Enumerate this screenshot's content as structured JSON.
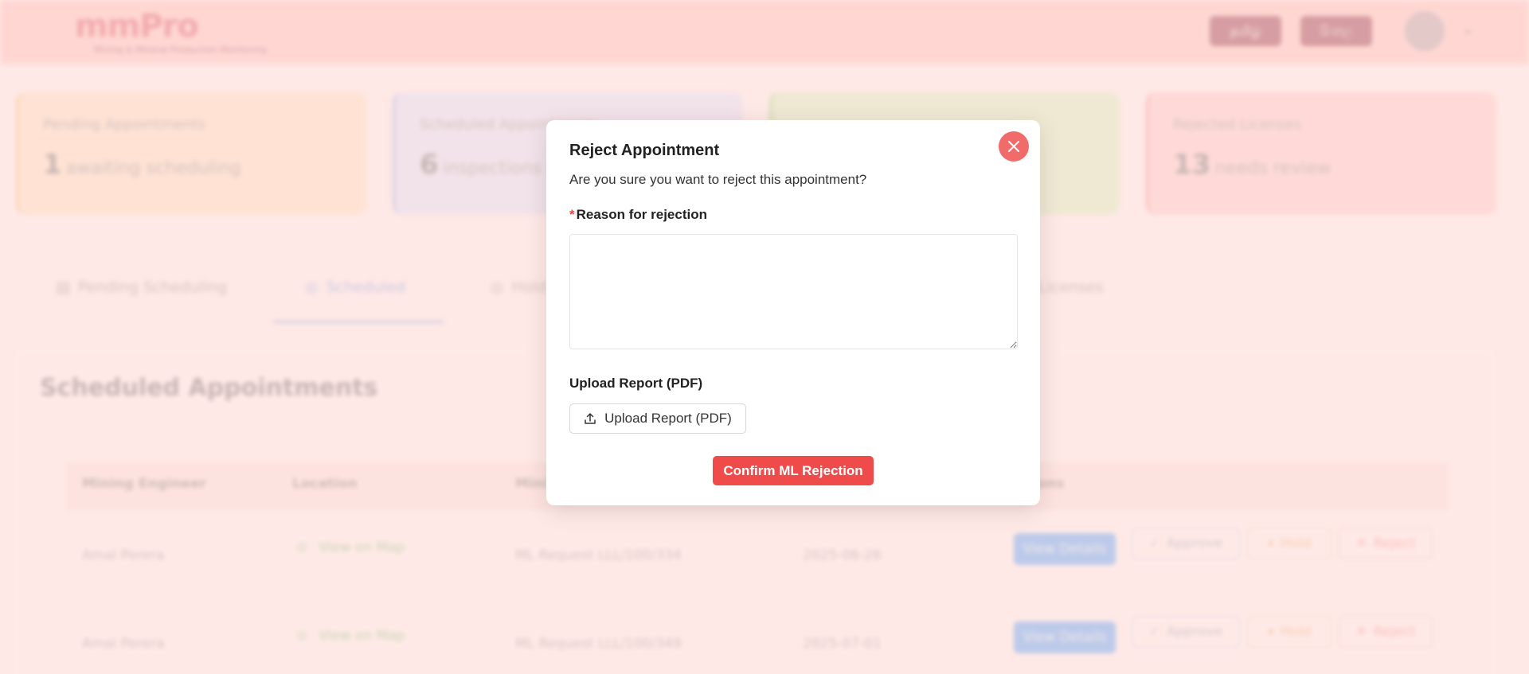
{
  "header": {
    "logo": "mmPro",
    "logo_subtitle": "Mining & Mineral Production Monitoring",
    "lang_tamil": "தமிழ்",
    "lang_sinhala": "සිංහල"
  },
  "stats": [
    {
      "title": "Pending Appointments",
      "number": "1",
      "desc": "awaiting scheduling"
    },
    {
      "title": "Scheduled Appointments",
      "number": "6",
      "desc": "inspections pending"
    },
    {
      "title": "",
      "number": "",
      "desc": ""
    },
    {
      "title": "Rejected Licenses",
      "number": "13",
      "desc": "needs review"
    }
  ],
  "tabs": [
    {
      "label": "Pending Scheduling"
    },
    {
      "label": "Scheduled"
    },
    {
      "label": "Hold"
    },
    {
      "label": "Licenses"
    }
  ],
  "section_title": "Scheduled Appointments",
  "table": {
    "headers": [
      "Mining Engineer",
      "Location",
      "Mini",
      "ions"
    ],
    "rows": [
      {
        "engineer": "Amal Perera",
        "location": "View on Map",
        "license": "ML Request LLL/100/334",
        "date": "2025-06-26"
      },
      {
        "engineer": "Amal Perera",
        "location": "View on Map",
        "license": "ML Request LLL/100/349",
        "date": "2025-07-01"
      }
    ],
    "actions": {
      "view": "View Details",
      "approve": "Approve",
      "hold": "Hold",
      "reject": "Reject"
    }
  },
  "modal": {
    "title": "Reject Appointment",
    "message": "Are you sure you want to reject this appointment?",
    "reason_label": "Reason for rejection",
    "reason_value": "",
    "upload_label": "Upload Report (PDF)",
    "upload_button": "Upload Report (PDF)",
    "confirm_button": "Confirm ML Rejection"
  },
  "colors": {
    "danger": "#f04b4b",
    "close_button": "#f26b6b",
    "header_bg": "#ffc9c4",
    "primary": "#5aa8ff"
  }
}
